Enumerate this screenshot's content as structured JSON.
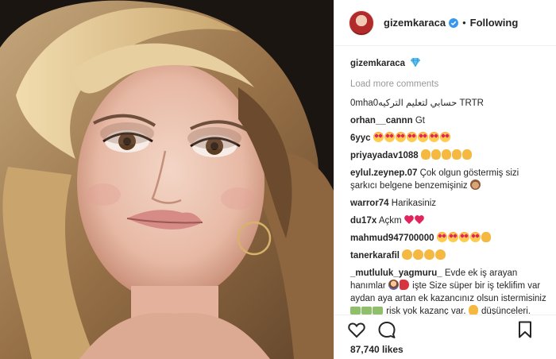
{
  "header": {
    "username": "gizemkaraca",
    "separator": "•",
    "follow_status": "Following"
  },
  "caption": {
    "username": "gizemkaraca",
    "emoji": "diamond-icon"
  },
  "load_more": "Load more comments",
  "comments": [
    {
      "user": "",
      "text": "0mha0حسابي لتعليم التركيه TRTR"
    },
    {
      "user": "orhan__cannn",
      "text": "Gt"
    },
    {
      "user": "6yyc",
      "text": ""
    },
    {
      "user": "priyayadav1088",
      "text": ""
    },
    {
      "user": "eylul.zeynep.07",
      "text": "Çok olgun göstermiş sizi şarkıcı belgene benzemişiniz"
    },
    {
      "user": "warror74",
      "text": "Harikasiniz"
    },
    {
      "user": "du17x",
      "text": "Açkm"
    },
    {
      "user": "mahmud947700000",
      "text": ""
    },
    {
      "user": "tanerkarafil",
      "text": ""
    },
    {
      "user": "_mutluluk_yagmuru_",
      "text": "Evde ek iş arayan hanımlar",
      "text2": "işte Size süper bir iş teklifim var aydan aya artan ek kazancınız olsun istermisiniz",
      "text3": "risk yok kazanç var.",
      "text4": "düşünceleri. Ayrıntılı bilgi için geri atın bana"
    }
  ],
  "likes": "87,740 likes",
  "colors": {
    "verified": "#3897f0",
    "text": "#262626",
    "muted": "#999999",
    "border": "#efefef"
  }
}
